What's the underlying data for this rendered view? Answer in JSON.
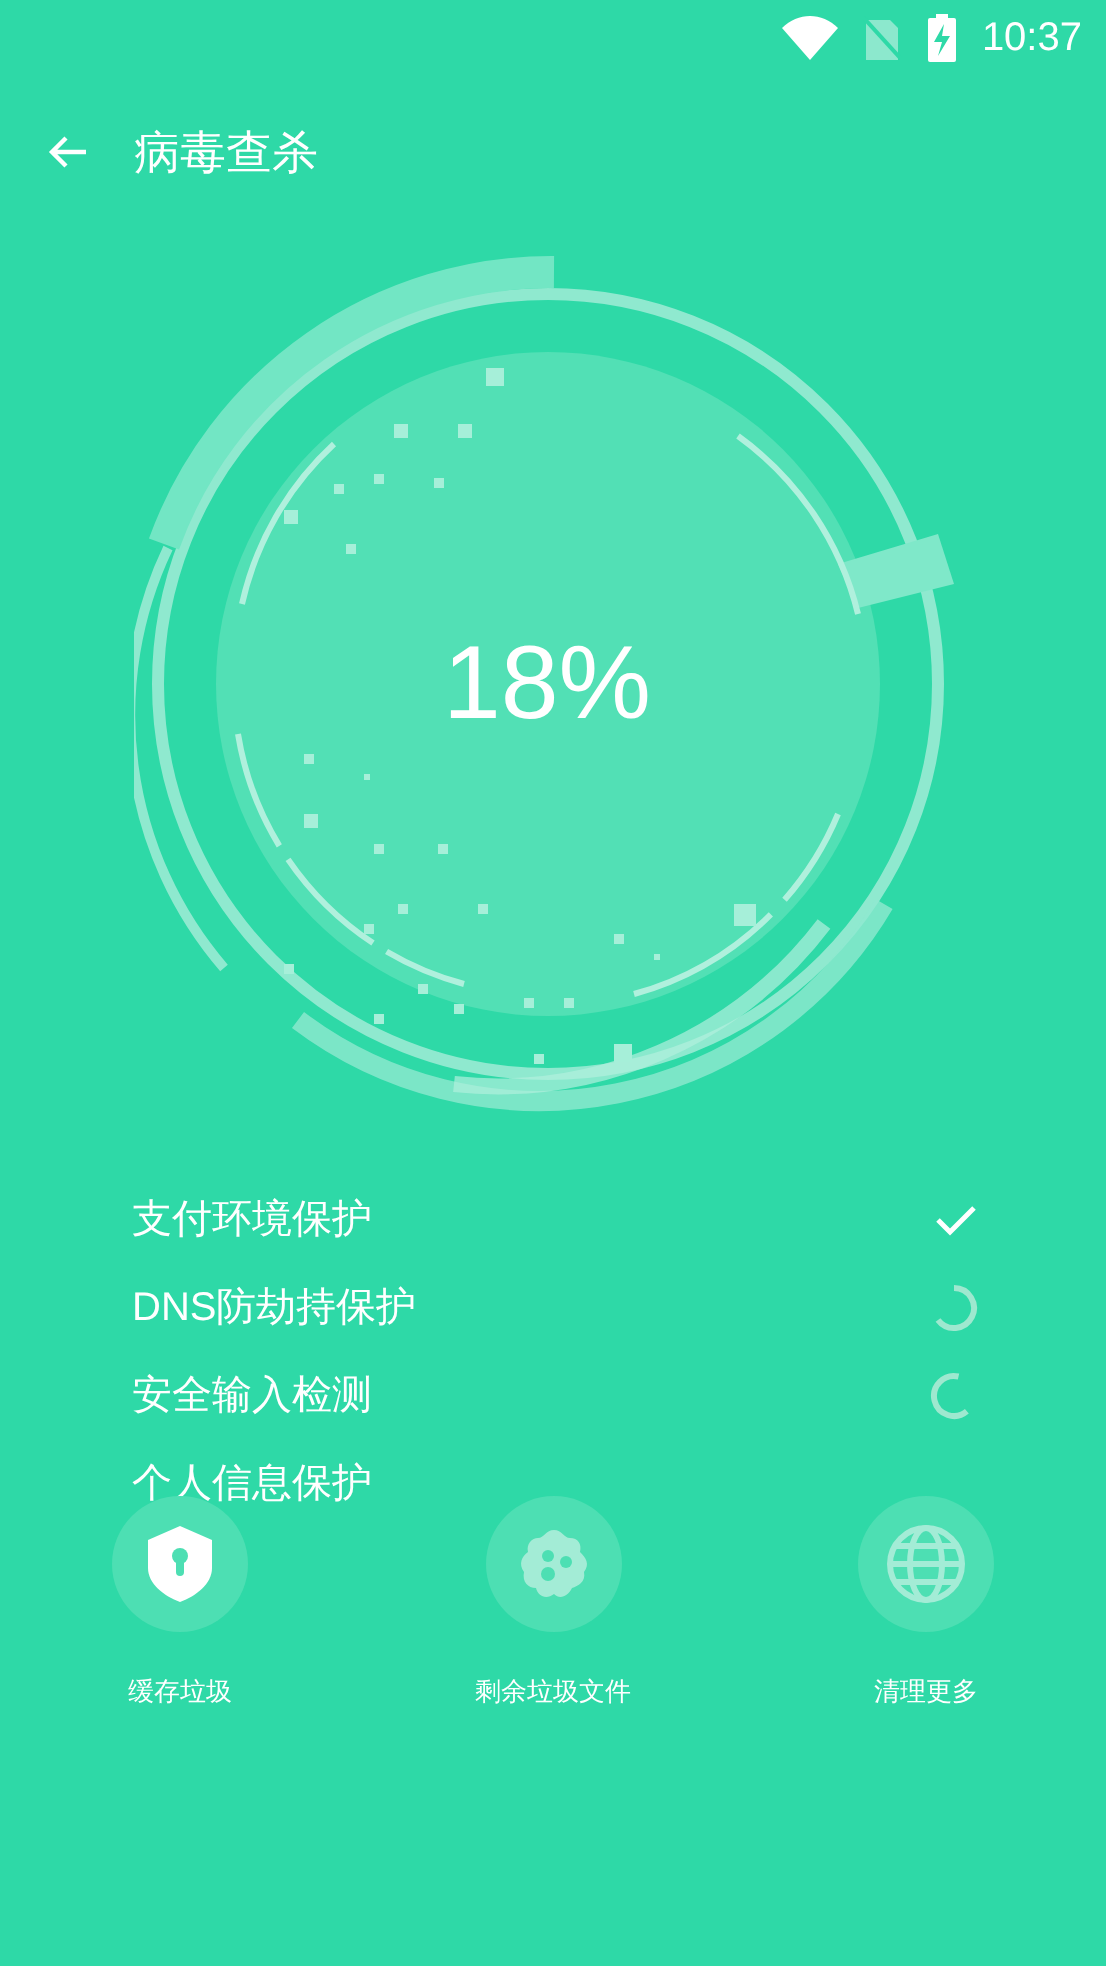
{
  "status_bar": {
    "time": "10:37"
  },
  "header": {
    "title": "病毒查杀"
  },
  "scan": {
    "percent": "18%"
  },
  "checks": [
    {
      "label": "支付环境保护",
      "kind": "done"
    },
    {
      "label": "DNS防劫持保护",
      "kind": "scanning"
    },
    {
      "label": "安全输入检测",
      "kind": "scanning"
    },
    {
      "label": "个人信息保护",
      "kind": "pending"
    }
  ],
  "actions": [
    {
      "label": "缓存垃圾",
      "kind": "shield",
      "active": true
    },
    {
      "label": "剩余垃圾文件",
      "kind": "virus",
      "active": false
    },
    {
      "label": "清理更多",
      "kind": "globe",
      "active": false
    }
  ]
}
